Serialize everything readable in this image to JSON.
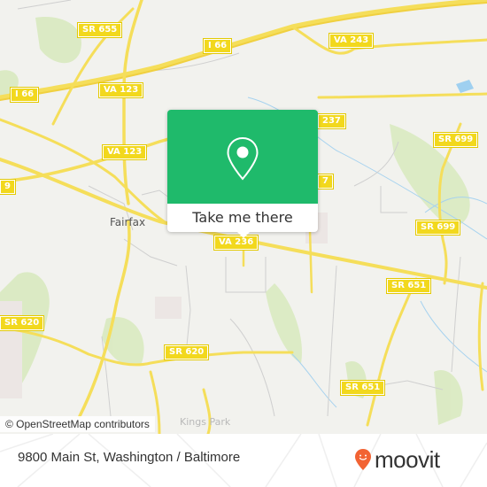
{
  "map": {
    "road_labels": [
      {
        "text": "SR 655"
      },
      {
        "text": "I 66"
      },
      {
        "text": "I 66"
      },
      {
        "text": "VA 123"
      },
      {
        "text": "VA 243"
      },
      {
        "text": "VA 123"
      },
      {
        "text": "237"
      },
      {
        "text": "9"
      },
      {
        "text": "7"
      },
      {
        "text": "SR 699"
      },
      {
        "text": "SR 699"
      },
      {
        "text": "VA 236"
      },
      {
        "text": "SR 651"
      },
      {
        "text": "SR 620"
      },
      {
        "text": "SR 620"
      },
      {
        "text": "SR 651"
      }
    ],
    "places": [
      {
        "text": "Fairfax"
      },
      {
        "text": "Kings Park"
      }
    ],
    "attribution": "© OpenStreetMap contributors",
    "colors": {
      "background": "#f2f2ee",
      "road": "#f5de5a",
      "shield": "#f2d81d",
      "park": "#d4e8b8",
      "water": "#9fd0f0"
    }
  },
  "popup": {
    "icon": "location-pin-icon",
    "cta_label": "Take me there",
    "color": "#1fba6b"
  },
  "footer": {
    "address": "9800 Main St, Washington / Baltimore",
    "brand": "moovit",
    "brand_icon": "moovit-smiley-pin-icon",
    "brand_color": "#f26333"
  }
}
